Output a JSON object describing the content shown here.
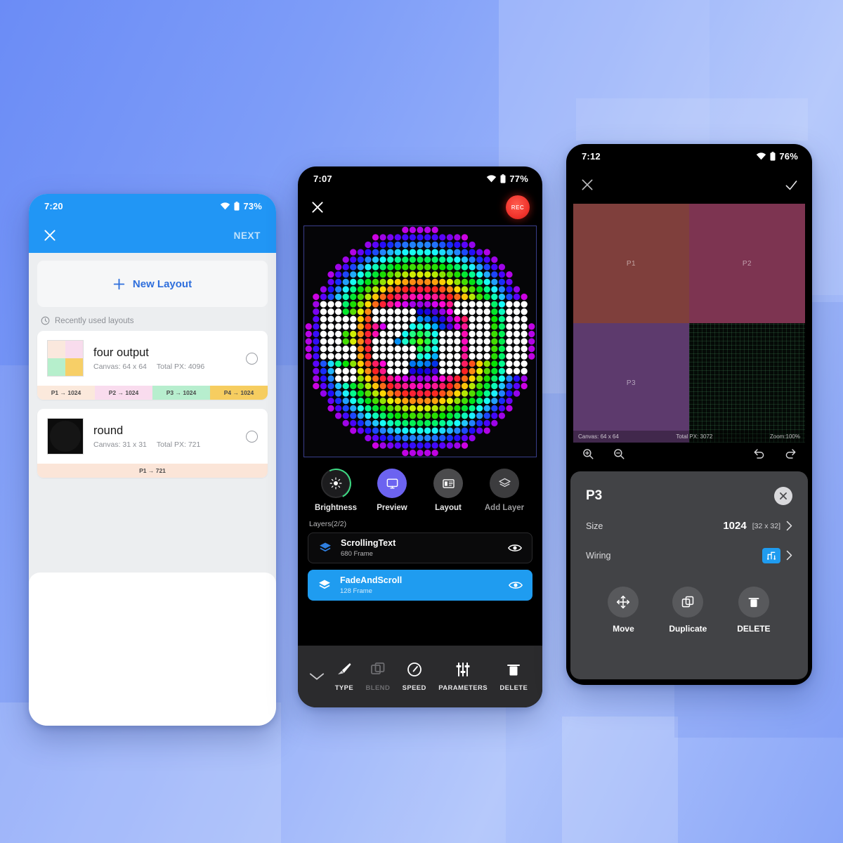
{
  "background": {
    "accent": "#6b8cf6",
    "accent_light": "#aec3fb"
  },
  "left_phone": {
    "status": {
      "time": "7:20",
      "battery": "73%",
      "wifi_icon": "wifi-icon",
      "battery_icon": "battery-icon"
    },
    "appbar": {
      "close_icon": "close-icon",
      "next_label": "NEXT"
    },
    "new_layout": {
      "label": "New Layout",
      "icon": "plus-icon"
    },
    "recent_header": {
      "label": "Recently used layouts",
      "icon": "clock-icon"
    },
    "layouts": [
      {
        "title": "four output",
        "canvas": "Canvas: 64 x 64",
        "total": "Total PX: 4096",
        "thumb_colors": [
          "#fae8dd",
          "#f8dced",
          "#b6efcc",
          "#f7cf67"
        ],
        "ports": [
          {
            "label": "P1 → 1024",
            "color": "#fbe9dc"
          },
          {
            "label": "P2 → 1024",
            "color": "#f9dcee"
          },
          {
            "label": "P3 → 1024",
            "color": "#b7eece"
          },
          {
            "label": "P4 → 1024",
            "color": "#f6cd60"
          }
        ]
      },
      {
        "title": "round",
        "canvas": "Canvas: 31 x 31",
        "total": "Total PX: 721",
        "thumb_colors": [
          "#0c0c0c",
          "#0c0c0c",
          "#0c0c0c",
          "#0c0c0c"
        ],
        "ports": [
          {
            "label": "P1 → 721",
            "color": "#fbe5d8"
          }
        ]
      }
    ]
  },
  "mid_phone": {
    "status": {
      "time": "7:07",
      "battery": "77%",
      "wifi_icon": "wifi-icon",
      "battery_icon": "battery-icon"
    },
    "appbar": {
      "close_icon": "close-icon",
      "rec_label": "REC"
    },
    "preview": {
      "canvas_name": "led-matrix-preview"
    },
    "tools": [
      {
        "label": "Brightness",
        "icon": "brightness-icon",
        "active": false
      },
      {
        "label": "Preview",
        "icon": "monitor-icon",
        "active": true
      },
      {
        "label": "Layout",
        "icon": "layout-grid-icon",
        "active": false
      },
      {
        "label": "Add Layer",
        "icon": "layers-plus-icon",
        "active": false
      }
    ],
    "layers_header": "Layers(2/2)",
    "layers": [
      {
        "name": "ScrollingText",
        "frames": "680 Frame",
        "selected": false,
        "visibility_icon": "eye-icon"
      },
      {
        "name": "FadeAndScroll",
        "frames": "128 Frame",
        "selected": true,
        "visibility_icon": "eye-icon"
      }
    ],
    "bottom_bar": {
      "collapse_icon": "chevron-down-icon",
      "items": [
        {
          "label": "TYPE",
          "icon": "brush-icon",
          "dim": false
        },
        {
          "label": "BLEND",
          "icon": "copy-layers-icon",
          "dim": true
        },
        {
          "label": "SPEED",
          "icon": "speedometer-icon",
          "dim": false
        },
        {
          "label": "PARAMETERS",
          "icon": "sliders-icon",
          "dim": false
        },
        {
          "label": "DELETE",
          "icon": "trash-icon",
          "dim": false
        }
      ]
    }
  },
  "right_phone": {
    "status": {
      "time": "7:12",
      "battery": "76%",
      "wifi_icon": "wifi-icon",
      "battery_icon": "battery-icon"
    },
    "appbar": {
      "close_icon": "close-icon",
      "confirm_icon": "check-icon"
    },
    "regions": [
      {
        "label": "P1",
        "color": "#7f3f3c"
      },
      {
        "label": "P2",
        "color": "#7d3451"
      },
      {
        "label": "P3",
        "color": "#5d3a6d"
      },
      {
        "label": "",
        "color": "#050a07"
      }
    ],
    "canvas_status": {
      "canvas": "Canvas: 64 x 64",
      "total": "Total PX: 3072",
      "zoom": "Zoom:100%"
    },
    "canvas_tools": [
      {
        "icon": "zoom-in-icon"
      },
      {
        "icon": "zoom-out-icon"
      },
      {
        "icon": "undo-icon"
      },
      {
        "icon": "redo-icon"
      }
    ],
    "sheet": {
      "title": "P3",
      "close_icon": "close-circle-icon",
      "rows": [
        {
          "key": "Size",
          "value": "1024",
          "detail": "[32 x 32]",
          "chevron": "chevron-right-icon"
        },
        {
          "key": "Wiring",
          "value": "",
          "detail": "",
          "chevron": "chevron-right-icon",
          "icon": "wiring-icon"
        }
      ],
      "actions": [
        {
          "label": "Move",
          "icon": "move-icon"
        },
        {
          "label": "Duplicate",
          "icon": "duplicate-icon"
        },
        {
          "label": "DELETE",
          "icon": "trash-icon"
        }
      ]
    }
  }
}
